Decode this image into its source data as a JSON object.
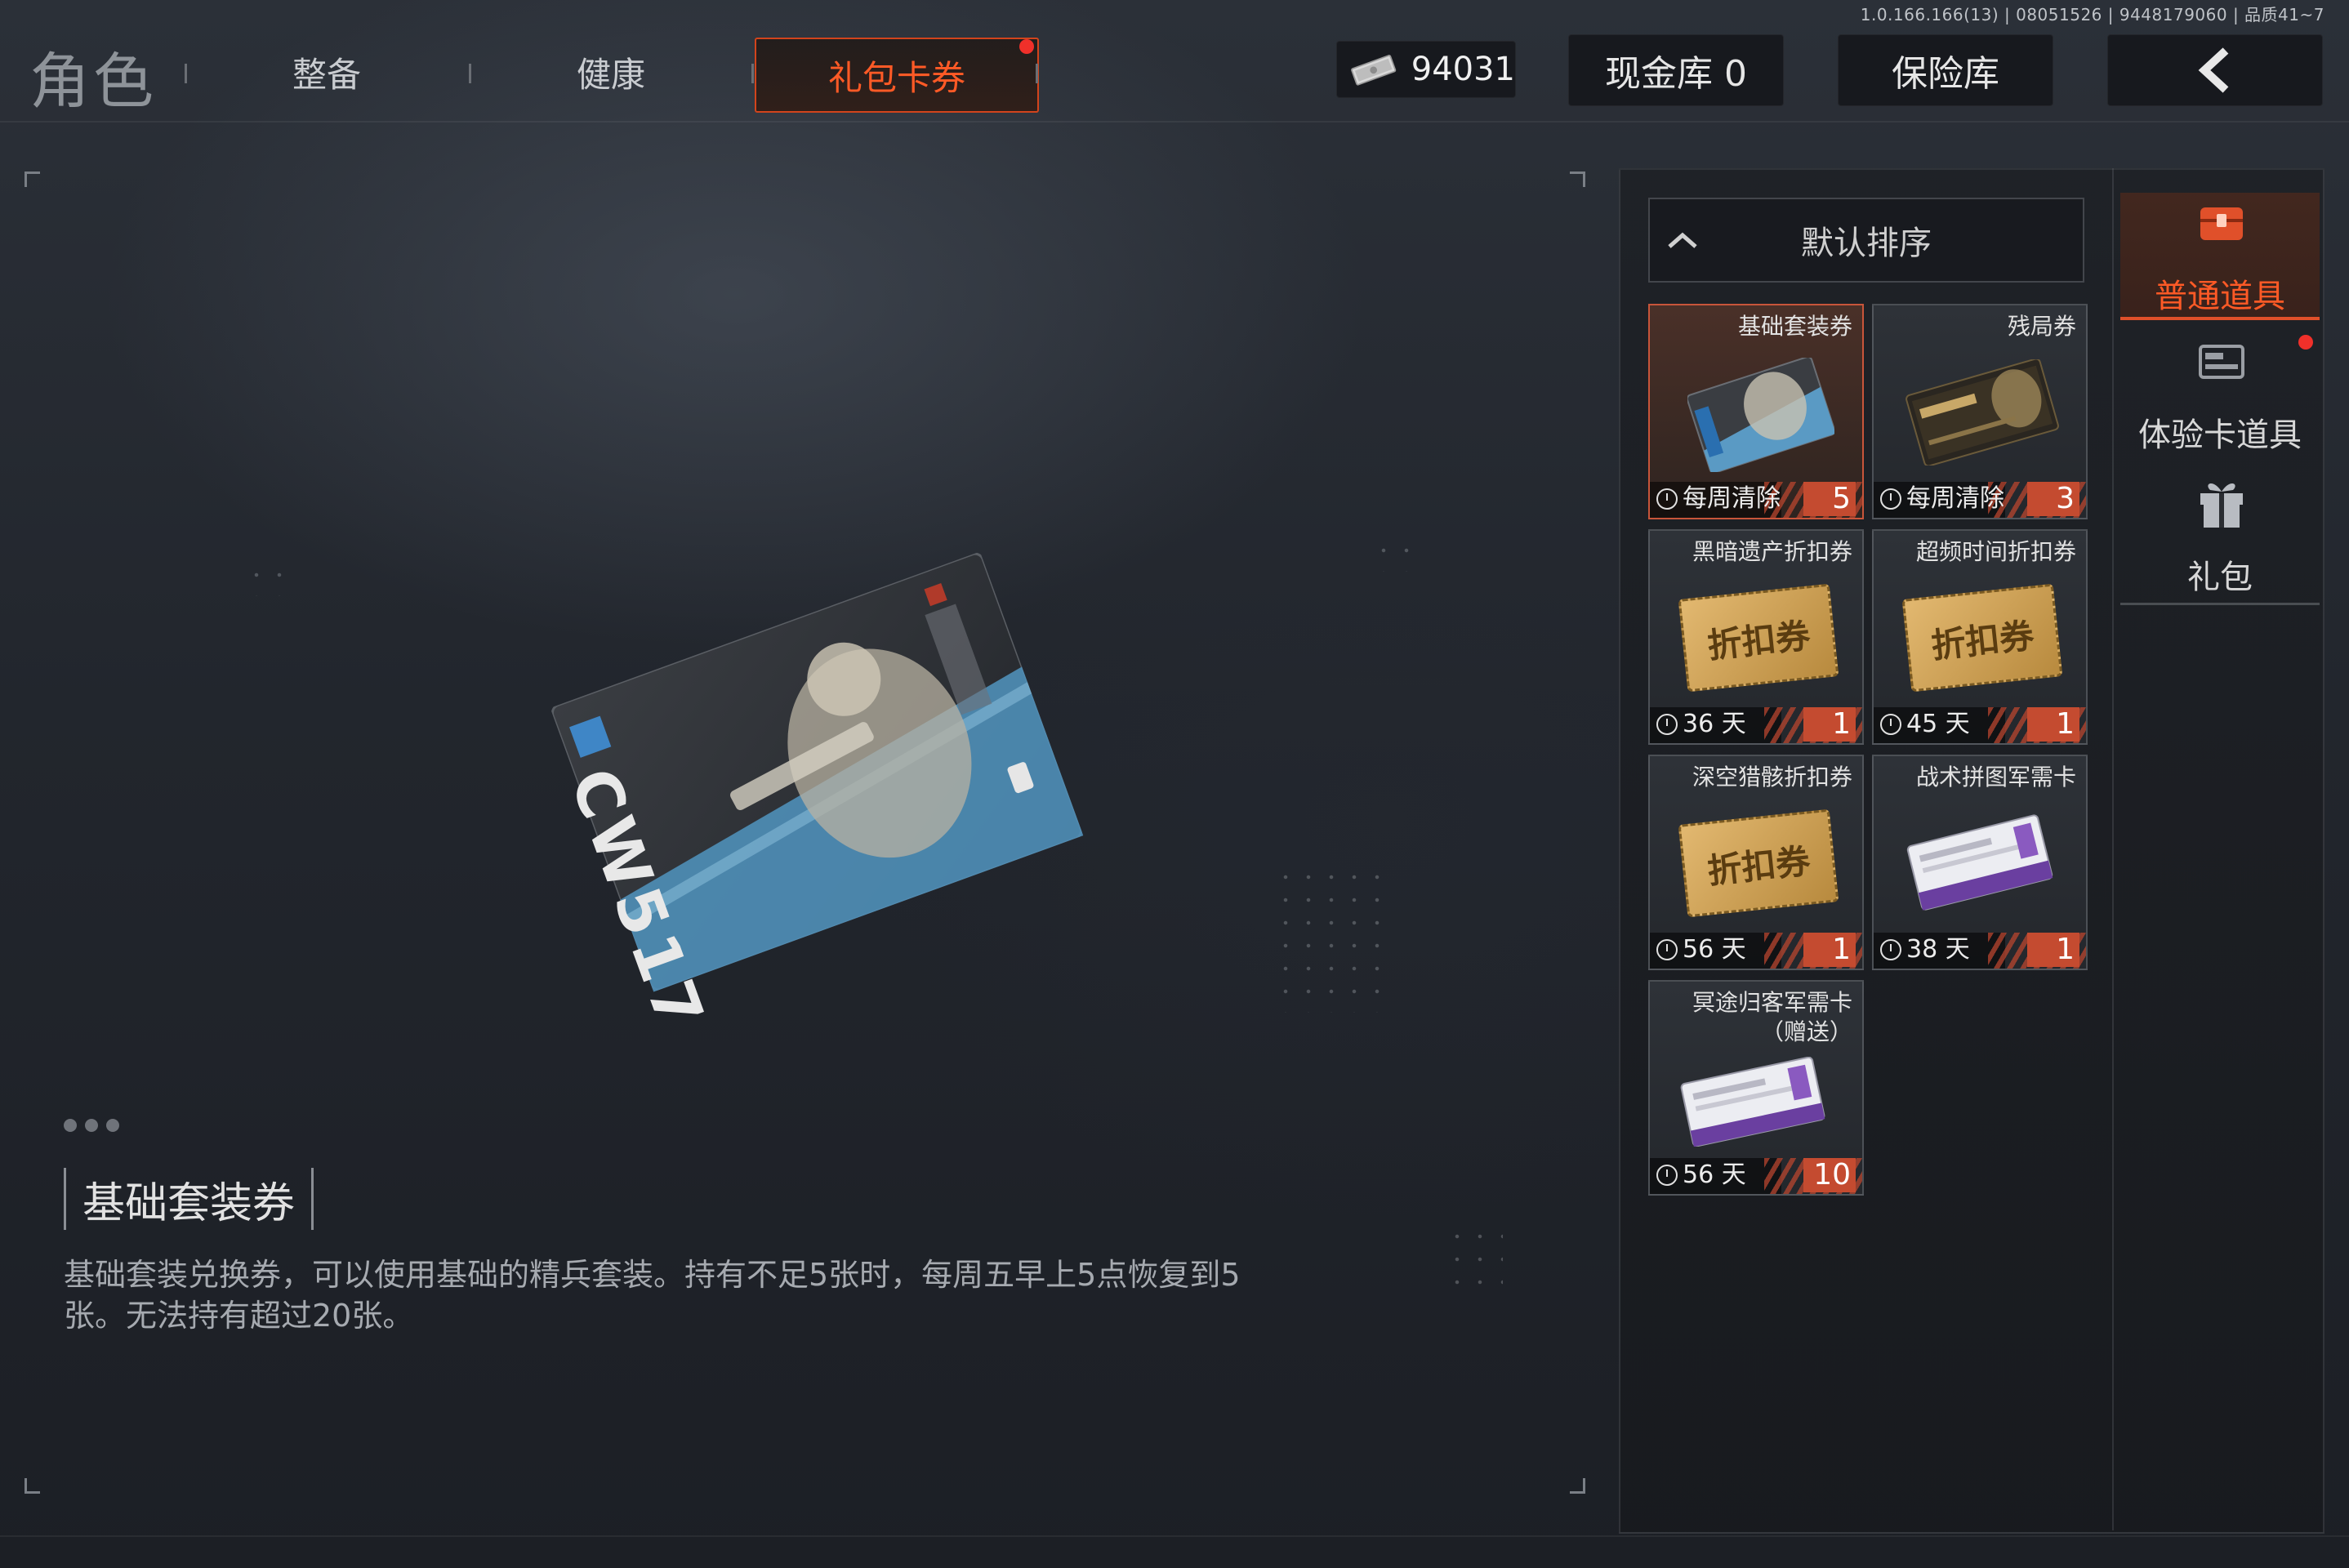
{
  "version_info": "1.0.166.166(13) | 08051526 | 9448179060 | 品质41~7",
  "header": {
    "title": "角色",
    "tabs": [
      {
        "label": "整备"
      },
      {
        "label": "健康"
      },
      {
        "label": "礼包卡券"
      }
    ],
    "currency_amount": "94031",
    "cash_vault_button": "现金库 0",
    "safe_vault_button": "保险库",
    "back_icon": "chevron-left-icon"
  },
  "sort": {
    "label": "默认排序",
    "icon": "chevron-up-icon"
  },
  "items": [
    {
      "name": "基础套装券",
      "timer": "每周清除",
      "count": "5",
      "image": "CW517 card"
    },
    {
      "name": "残局券",
      "timer": "每周清除",
      "count": "3",
      "image": "KAMONA card"
    },
    {
      "name": "黑暗遗产折扣券",
      "timer": "36 天",
      "count": "1",
      "ticket_text": "折扣券"
    },
    {
      "name": "超频时间折扣券",
      "timer": "45 天",
      "count": "1",
      "ticket_text": "折扣券"
    },
    {
      "name": "深空猎骸折扣券",
      "timer": "56 天",
      "count": "1",
      "ticket_text": "折扣券"
    },
    {
      "name": "战术拼图军需卡",
      "timer": "38 天",
      "count": "1"
    },
    {
      "name": "冥途归客军需卡",
      "name_line2": "（赠送）",
      "timer": "56 天",
      "count": "10"
    }
  ],
  "side_tabs": [
    {
      "label": "普通道具",
      "icon": "treasure-chest-icon"
    },
    {
      "label": "体验卡道具",
      "icon": "card-icon"
    },
    {
      "label": "礼包",
      "icon": "gift-icon"
    }
  ],
  "preview": {
    "card_text": "CW517"
  },
  "detail": {
    "title": "基础套装券",
    "description": "基础套装兑换券，可以使用基础的精兵套装。持有不足5张时，每周五早上5点恢复到5张。无法持有超过20张。"
  },
  "colors": {
    "accent": "#e0502a",
    "accent_text": "#ff5a26",
    "notify": "#f0302a"
  }
}
